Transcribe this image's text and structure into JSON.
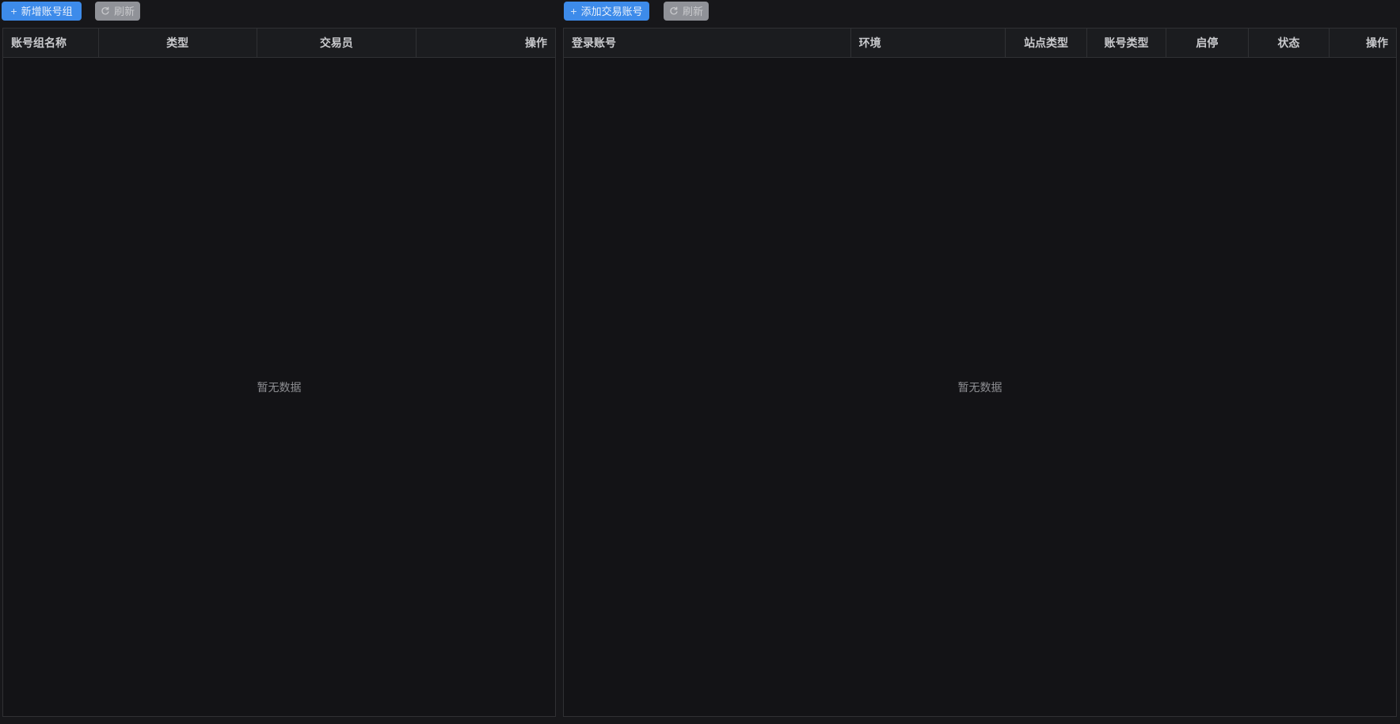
{
  "colors": {
    "primary_blue": "#3d8bea",
    "refresh_gray": "#909298",
    "page_bg": "#17171a",
    "table_bg": "#131316",
    "header_bg": "#1b1c1f",
    "border": "#303134",
    "empty_text": "#8d8e92"
  },
  "left_panel": {
    "toolbar": {
      "add_button_label": "新增账号组",
      "add_button_icon": "+",
      "refresh_button_label": "刷新"
    },
    "table": {
      "headers": [
        "账号组名称",
        "类型",
        "交易员",
        "操作"
      ],
      "rows": [],
      "empty_text": "暂无数据"
    }
  },
  "right_panel": {
    "toolbar": {
      "add_button_label": "添加交易账号",
      "add_button_icon": "+",
      "refresh_button_label": "刷新"
    },
    "table": {
      "headers": [
        "登录账号",
        "环境",
        "站点类型",
        "账号类型",
        "启停",
        "状态",
        "操作"
      ],
      "rows": [],
      "empty_text": "暂无数据"
    }
  }
}
